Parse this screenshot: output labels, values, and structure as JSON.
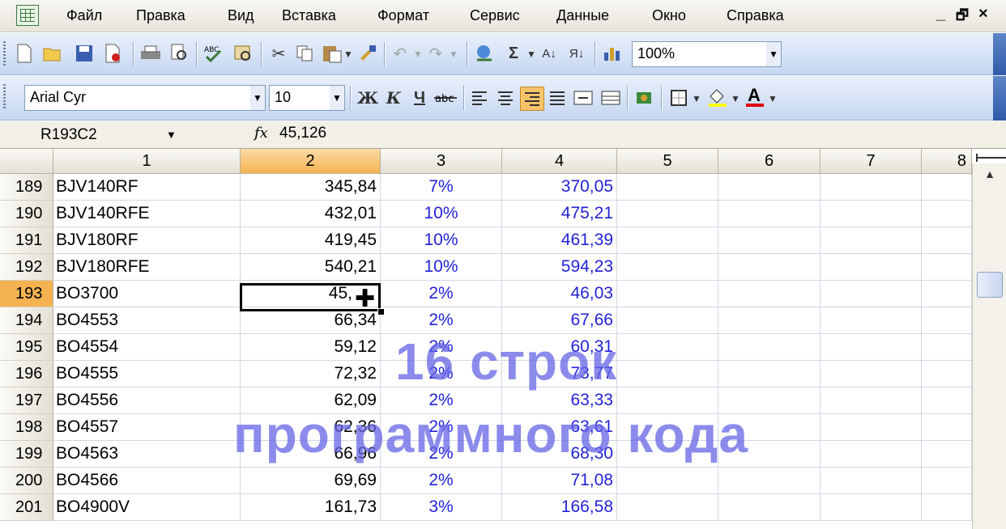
{
  "menu": {
    "items": [
      {
        "label": "Файл"
      },
      {
        "label": "Правка"
      },
      {
        "label": "Вид"
      },
      {
        "label": "Вставка"
      },
      {
        "label": "Формат"
      },
      {
        "label": "Сервис"
      },
      {
        "label": "Данные"
      },
      {
        "label": "Окно"
      },
      {
        "label": "Справка"
      }
    ],
    "window_controls": [
      "_",
      "🗗",
      "×"
    ]
  },
  "standard_toolbar": {
    "zoom": "100%",
    "icons": [
      "new-icon",
      "open-icon",
      "save-icon",
      "permission-icon",
      "print-icon",
      "print-preview-icon",
      "spelling-icon",
      "research-icon",
      "cut-icon",
      "copy-icon",
      "paste-icon",
      "format-painter-icon",
      "undo-icon",
      "redo-icon",
      "hyperlink-icon",
      "autosum-icon",
      "sort-ascending-icon",
      "sort-descending-icon",
      "chart-wizard-icon"
    ]
  },
  "formatting_toolbar": {
    "font": "Arial Cyr",
    "size": "10",
    "bold": "Ж",
    "italic": "К",
    "underline": "Ч"
  },
  "formula_bar": {
    "name_box": "R193C2",
    "fx": "fx",
    "value": "45,126"
  },
  "columns": [
    "1",
    "2",
    "3",
    "4",
    "5",
    "6",
    "7",
    "8"
  ],
  "active": {
    "row": "193",
    "col": "2"
  },
  "rows": [
    {
      "num": "189",
      "c1": "BJV140RF",
      "c2": "345,84",
      "c3": "7%",
      "c4": "370,05"
    },
    {
      "num": "190",
      "c1": "BJV140RFE",
      "c2": "432,01",
      "c3": "10%",
      "c4": "475,21"
    },
    {
      "num": "191",
      "c1": "BJV180RF",
      "c2": "419,45",
      "c3": "10%",
      "c4": "461,39"
    },
    {
      "num": "192",
      "c1": "BJV180RFE",
      "c2": "540,21",
      "c3": "10%",
      "c4": "594,23"
    },
    {
      "num": "193",
      "c1": "BO3700",
      "c2": "45,",
      "c3": "2%",
      "c4": "46,03"
    },
    {
      "num": "194",
      "c1": "BO4553",
      "c2": "66,34",
      "c3": "2%",
      "c4": "67,66"
    },
    {
      "num": "195",
      "c1": "BO4554",
      "c2": "59,12",
      "c3": "2%",
      "c4": "60,31"
    },
    {
      "num": "196",
      "c1": "BO4555",
      "c2": "72,32",
      "c3": "2%",
      "c4": "73,77"
    },
    {
      "num": "197",
      "c1": "BO4556",
      "c2": "62,09",
      "c3": "2%",
      "c4": "63,33"
    },
    {
      "num": "198",
      "c1": "BO4557",
      "c2": "62,36",
      "c3": "2%",
      "c4": "63,61"
    },
    {
      "num": "199",
      "c1": "BO4563",
      "c2": "66,96",
      "c3": "2%",
      "c4": "68,30"
    },
    {
      "num": "200",
      "c1": "BO4566",
      "c2": "69,69",
      "c3": "2%",
      "c4": "71,08"
    },
    {
      "num": "201",
      "c1": "BO4900V",
      "c2": "161,73",
      "c3": "3%",
      "c4": "166,58"
    }
  ],
  "overlay": {
    "line1": "16 строк",
    "line2": "программного кода"
  }
}
